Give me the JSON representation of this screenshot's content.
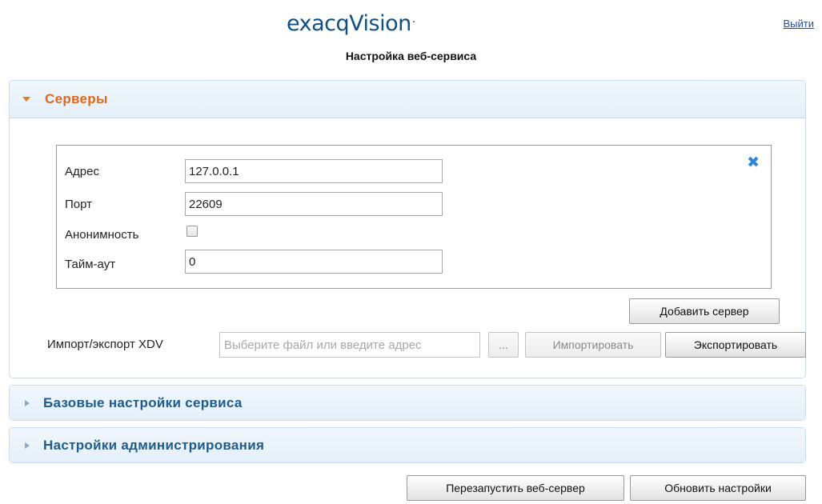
{
  "header": {
    "logo": "exacqVision",
    "logout": "Выйти",
    "title": "Настройка веб-сервиса"
  },
  "servers": {
    "title": "Серверы",
    "fields": {
      "address_label": "Адрес",
      "address_value": "127.0.0.1",
      "port_label": "Порт",
      "port_value": "22609",
      "anon_label": "Анонимность",
      "timeout_label": "Тайм-аут",
      "timeout_value": "0"
    },
    "add_server": "Добавить сервер",
    "import_label": "Импорт/экспорт XDV",
    "import_placeholder": "Выберите файл или введите адрес",
    "browse": "...",
    "import_btn": "Импортировать",
    "export_btn": "Экспортировать"
  },
  "sections": {
    "basic": "Базовые настройки сервиса",
    "admin": "Настройки администрирования"
  },
  "footer": {
    "restart": "Перезапустить веб-сервер",
    "update": "Обновить настройки"
  },
  "colors": {
    "active_header": "#e0681d",
    "section_header": "#1e5b8e",
    "remove_icon": "#2a86d6"
  }
}
